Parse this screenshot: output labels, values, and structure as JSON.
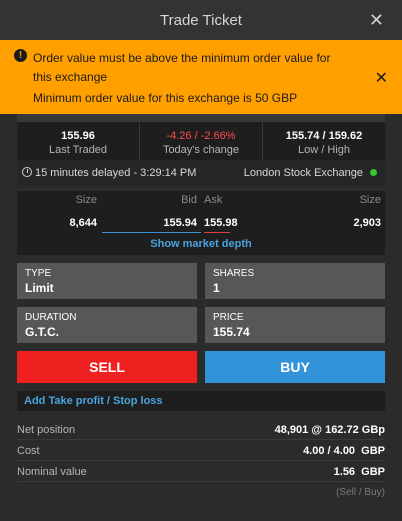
{
  "window": {
    "title": "Trade Ticket",
    "close": "✕"
  },
  "alert": {
    "line1": "Order value must be above the minimum order value for",
    "line2": "this exchange",
    "line3": "Minimum order value for this exchange is 50 GBP",
    "icon": "!",
    "close": "✕",
    "color": "#ff9f00"
  },
  "stats": {
    "last": {
      "value": "155.96",
      "label": "Last Traded"
    },
    "change": {
      "value": "-4.26 / -2.66%",
      "label": "Today's change",
      "color": "#ff4d4d"
    },
    "range": {
      "value": "155.74 / 159.62",
      "label": "Low / High"
    }
  },
  "delay": {
    "text": "15 minutes delayed - 3:29:14 PM",
    "exchange": "London Stock Exchange",
    "status_color": "#37c837"
  },
  "depth": {
    "headers": {
      "size_bid": "Size",
      "bid": "Bid",
      "ask": "Ask",
      "size_ask": "Size"
    },
    "row": {
      "size_bid": "8,644",
      "bid": "155.94",
      "ask": "155.98",
      "size_ask": "2,903"
    },
    "link": "Show market depth"
  },
  "form": {
    "type": {
      "label": "TYPE",
      "value": "Limit"
    },
    "shares": {
      "label": "SHARES",
      "value": "1"
    },
    "duration": {
      "label": "DURATION",
      "value": "G.T.C."
    },
    "price": {
      "label": "PRICE",
      "value": "155.74"
    }
  },
  "actions": {
    "sell": "SELL",
    "buy": "BUY",
    "sell_color": "#ef2020",
    "buy_color": "#3293d8"
  },
  "add_tp_sl": "Add Take profit / Stop loss",
  "summary": {
    "net_position": {
      "label": "Net position",
      "value": "48,901 @ 162.72 GBp"
    },
    "cost": {
      "label": "Cost",
      "value": "4.00 / 4.00  GBP"
    },
    "nominal": {
      "label": "Nominal value",
      "value": "1.56  GBP"
    },
    "footnote": "(Sell / Buy)"
  }
}
